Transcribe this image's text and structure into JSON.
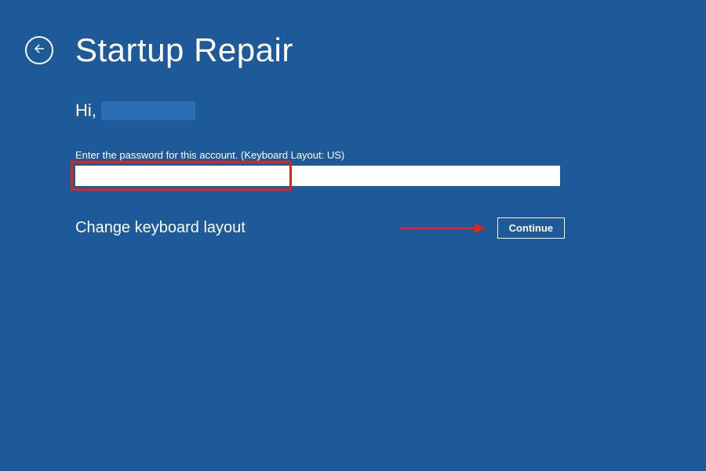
{
  "header": {
    "title": "Startup Repair"
  },
  "greeting": {
    "prefix": "Hi,"
  },
  "form": {
    "instruction": "Enter the password for this account. (Keyboard Layout: US)",
    "password_value": ""
  },
  "actions": {
    "change_layout_label": "Change keyboard layout",
    "continue_label": "Continue"
  },
  "colors": {
    "background": "#1e5a99",
    "accent_highlight": "#e1231a",
    "text": "#ffffff"
  }
}
